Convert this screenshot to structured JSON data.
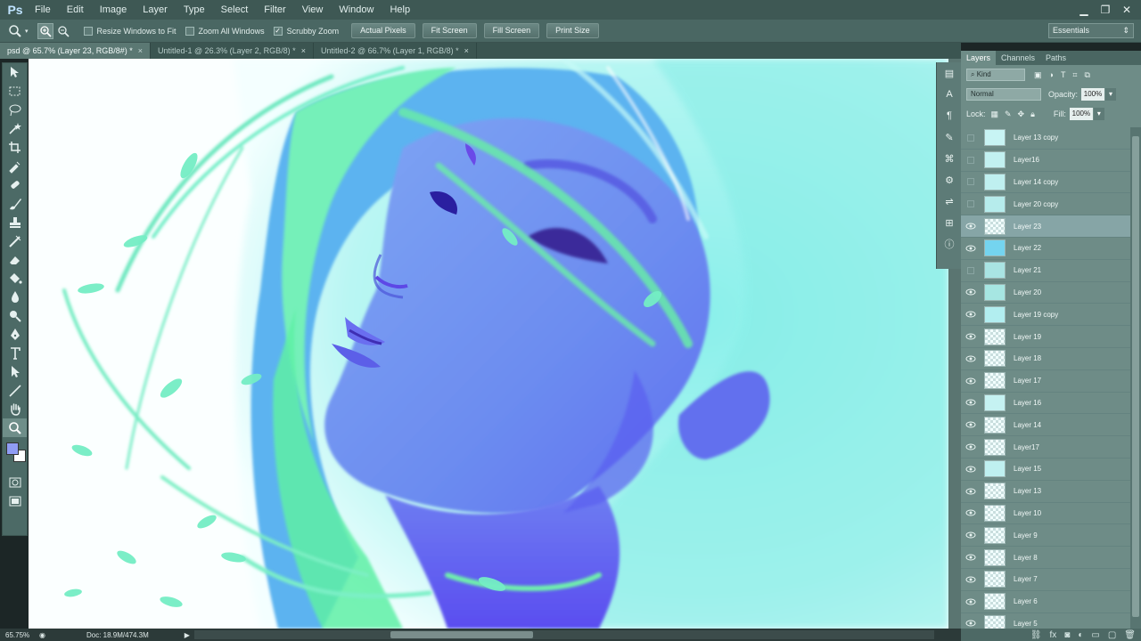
{
  "app": {
    "logo": "Ps"
  },
  "menu": [
    "File",
    "Edit",
    "Image",
    "Layer",
    "Type",
    "Select",
    "Filter",
    "View",
    "Window",
    "Help"
  ],
  "options": {
    "resize_windows": "Resize Windows to Fit",
    "zoom_all": "Zoom All Windows",
    "scrubby_zoom": "Scrubby Zoom",
    "buttons": [
      "Actual Pixels",
      "Fit Screen",
      "Fill Screen",
      "Print Size"
    ],
    "workspace": "Essentials"
  },
  "tabs": [
    {
      "label": "psd @ 65.7% (Layer 23, RGB/8#) *",
      "close": "×"
    },
    {
      "label": "Untitled-1 @ 26.3% (Layer 2, RGB/8) *",
      "close": "×"
    },
    {
      "label": "Untitled-2 @ 66.7% (Layer 1, RGB/8) *",
      "close": "×"
    }
  ],
  "panel": {
    "tabs": [
      "Layers",
      "Channels",
      "Paths"
    ],
    "kind": "Kind",
    "blend_mode": "Normal",
    "opacity_label": "Opacity:",
    "opacity_value": "100%",
    "lock_label": "Lock:",
    "fill_label": "Fill:",
    "fill_value": "100%"
  },
  "layers": [
    {
      "name": "Layer 13 copy",
      "visible": false,
      "thumb": "#c8f4f4"
    },
    {
      "name": "Layer16",
      "visible": false,
      "thumb": "#c2f1f1"
    },
    {
      "name": "Layer 14 copy",
      "visible": false,
      "thumb": "#bff0f0"
    },
    {
      "name": "Layer 20 copy",
      "visible": false,
      "thumb": "#b6ecec"
    },
    {
      "name": "Layer 23",
      "visible": true,
      "thumb": "checker",
      "selected": true
    },
    {
      "name": "Layer 22",
      "visible": true,
      "thumb": "#74d4ef"
    },
    {
      "name": "Layer 21",
      "visible": false,
      "thumb": "#a9e4e3"
    },
    {
      "name": "Layer 20",
      "visible": true,
      "thumb": "#a6e6e2"
    },
    {
      "name": "Layer 19 copy",
      "visible": true,
      "thumb": "#b2eef0"
    },
    {
      "name": "Layer 19",
      "visible": true,
      "thumb": "checker"
    },
    {
      "name": "Layer 18",
      "visible": true,
      "thumb": "checker"
    },
    {
      "name": "Layer 17",
      "visible": true,
      "thumb": "checker"
    },
    {
      "name": "Layer 16",
      "visible": true,
      "thumb": "#c5f2f2"
    },
    {
      "name": "Layer 14",
      "visible": true,
      "thumb": "checker"
    },
    {
      "name": "Layer17",
      "visible": true,
      "thumb": "checker"
    },
    {
      "name": "Layer 15",
      "visible": true,
      "thumb": "#bff0f0"
    },
    {
      "name": "Layer 13",
      "visible": true,
      "thumb": "checker"
    },
    {
      "name": "Layer 10",
      "visible": true,
      "thumb": "checker"
    },
    {
      "name": "Layer 9",
      "visible": true,
      "thumb": "checker"
    },
    {
      "name": "Layer 8",
      "visible": true,
      "thumb": "checker"
    },
    {
      "name": "Layer 7",
      "visible": true,
      "thumb": "checker"
    },
    {
      "name": "Layer 6",
      "visible": true,
      "thumb": "checker"
    },
    {
      "name": "Layer 5",
      "visible": true,
      "thumb": "checker"
    }
  ],
  "status": {
    "zoom": "65.75%",
    "doc": "Doc: 18.9M/474.3M"
  },
  "colors": {
    "foreground": "#8f9cf4",
    "background": "#ffffff"
  }
}
